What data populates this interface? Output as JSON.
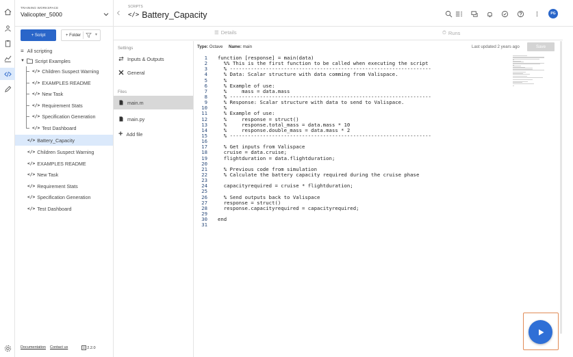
{
  "workspace": {
    "label": "TRAINING WORKSPACE",
    "name": "Valicopter_5000"
  },
  "header": {
    "breadcrumb": "SCRIPTS",
    "title_icon": "</>",
    "title": "Battery_Capacity",
    "avatar": "PG"
  },
  "toolbar": {
    "new_script": "+ Script",
    "new_folder": "+ Folder"
  },
  "tree": {
    "all": "All scripting",
    "folder": "Script Examples",
    "folder_children": [
      "Children Suspect Warning",
      "EXAMPLES README",
      "New Task",
      "Requirement Stats",
      "Specification Generation",
      "Test Dashboard"
    ],
    "root_items": [
      "Battery_Capacity",
      "Children Suspect Warning",
      "EXAMPLES README",
      "New Task",
      "Requirement Stats",
      "Specification Generation",
      "Test Dashboard"
    ],
    "selected": "Battery_Capacity"
  },
  "footer": {
    "docs": "Documentation",
    "contact": "Contact us",
    "version": "2.2.0"
  },
  "tabs": {
    "details": "Details",
    "runs": "Runs"
  },
  "settings": {
    "section_settings": "Settings",
    "inputs_outputs": "Inputs & Outputs",
    "general": "General",
    "section_files": "Files",
    "files": [
      "main.m",
      "main.py"
    ],
    "add_file": "Add file"
  },
  "editor": {
    "type_label": "Type:",
    "type_value": "Octave",
    "name_label": "Name:",
    "name_value": "main",
    "updated": "Last updated 2 years ago",
    "save": "Save",
    "lines": [
      "function [response] = main(data)",
      "  %% This is the first function to be called when executing the script",
      "  % -------------------------------------------------------------------",
      "  % Data: Scalar structure with data comming from Valispace.",
      "  %",
      "  % Example of use:",
      "  %     mass = data.mass",
      "  % -------------------------------------------------------------------",
      "  % Response: Scalar structure with data to send to Valispace.",
      "  %",
      "  % Example of use:",
      "  %     response = struct()",
      "  %     response.total_mass = data.mass * 10",
      "  %     response.double_mass = data.mass * 2",
      "  % -------------------------------------------------------------------",
      "",
      "  % Get inputs from Valispace",
      "  cruise = data.cruise;",
      "  flightduration = data.flightduration;",
      "",
      "  % Previous code from simulation",
      "  % Calculate the battery capacity required during the cruise phase",
      "",
      "  capacityrequired = cruise * flightduration;",
      "",
      "  % Send outputs back to Valispace",
      "  response = struct()",
      "  response.capacityrequired = capacityrequired;",
      "",
      "end",
      ""
    ]
  },
  "colors": {
    "accent": "#2a66c9",
    "run": "#2f6fd6",
    "highlight": "#e08a55",
    "selected_bg": "#dbe9fb"
  }
}
